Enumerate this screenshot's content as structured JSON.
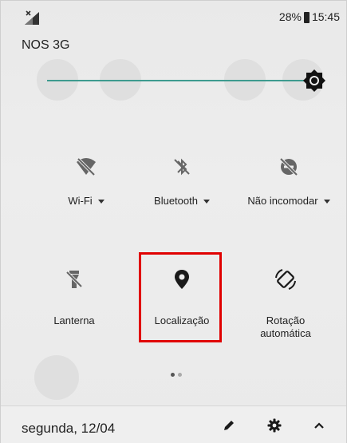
{
  "status_bar": {
    "battery_percent": "28%",
    "time": "15:45",
    "signal_icon": "no-signal-icon",
    "battery_icon": "battery-icon"
  },
  "carrier": "NOS 3G",
  "brightness": {
    "level": 1.0,
    "icon": "brightness-icon",
    "accent_color": "#3e9b8f"
  },
  "tiles_row1": [
    {
      "label": "Wi-Fi",
      "icon": "wifi-off-icon",
      "has_dropdown": true
    },
    {
      "label": "Bluetooth",
      "icon": "bluetooth-off-icon",
      "has_dropdown": true
    },
    {
      "label": "Não incomodar",
      "icon": "do-not-disturb-off-icon",
      "has_dropdown": true
    }
  ],
  "tiles_row2": [
    {
      "label": "Lanterna",
      "icon": "flashlight-off-icon"
    },
    {
      "label": "Localização",
      "icon": "location-pin-icon",
      "highlighted": true,
      "highlight_color": "#e00000"
    },
    {
      "label_line1": "Rotação",
      "label_line2": "automática",
      "icon": "auto-rotate-icon"
    }
  ],
  "pages": {
    "count": 2,
    "current": 1
  },
  "footer": {
    "date": "segunda, 12/04",
    "edit_icon": "edit-pencil-icon",
    "settings_icon": "gear-icon",
    "collapse_icon": "chevron-up-icon"
  }
}
